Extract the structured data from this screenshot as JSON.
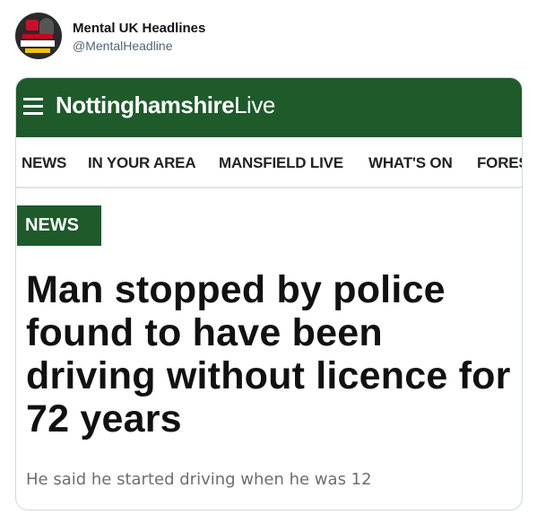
{
  "tweet": {
    "author_name": "Mental UK Headlines",
    "author_handle": "@MentalHeadline",
    "avatar_icon": "news-presenter-avatar-icon"
  },
  "card": {
    "site": {
      "name_bold": "Nottinghamshire",
      "name_light": "Live",
      "menu_icon": "hamburger-menu-icon",
      "brand_color": "#1e5a2a"
    },
    "nav": {
      "items": [
        "NEWS",
        "IN YOUR AREA",
        "MANSFIELD LIVE",
        "WHAT'S ON",
        "FORES"
      ]
    },
    "section_tag": "NEWS",
    "headline": "Man stopped by police found to have been driving without licence for 72 years",
    "standfirst": "He said he started driving when he was 12"
  }
}
